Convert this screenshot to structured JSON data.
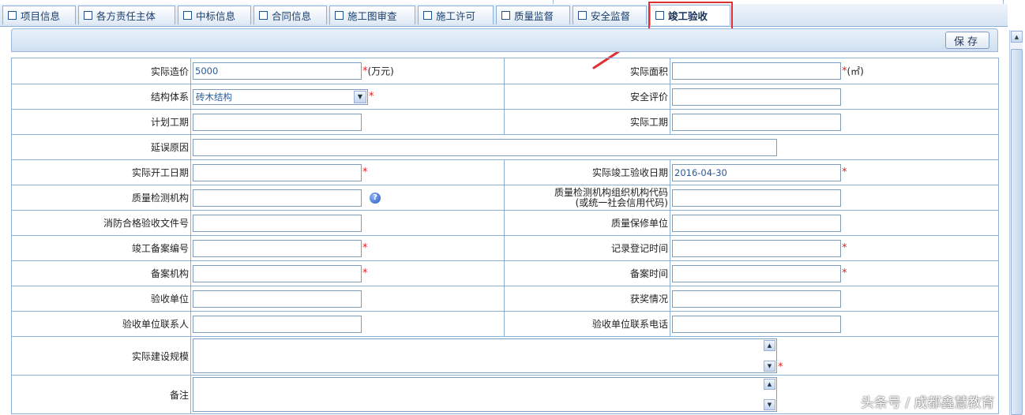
{
  "tabs": [
    {
      "label": "项目信息"
    },
    {
      "label": "各方责任主体"
    },
    {
      "label": "中标信息"
    },
    {
      "label": "合同信息"
    },
    {
      "label": "施工图审查"
    },
    {
      "label": "施工许可"
    },
    {
      "label": "质量监督"
    },
    {
      "label": "安全监督"
    },
    {
      "label": "竣工验收",
      "active": true
    }
  ],
  "toolbar": {
    "save_label": "保存"
  },
  "form": {
    "actual_cost": {
      "label": "实际造价",
      "value": "5000",
      "unit": "(万元)"
    },
    "actual_area": {
      "label": "实际面积",
      "value": "",
      "unit": "(㎡)"
    },
    "structure": {
      "label": "结构体系",
      "value": "砖木结构"
    },
    "safety_eval": {
      "label": "安全评价",
      "value": ""
    },
    "planned_period": {
      "label": "计划工期",
      "value": ""
    },
    "actual_period": {
      "label": "实际工期",
      "value": ""
    },
    "delay_reason": {
      "label": "延误原因",
      "value": ""
    },
    "start_date": {
      "label": "实际开工日期",
      "value": ""
    },
    "completion_date": {
      "label": "实际竣工验收日期",
      "value": "2016-04-30"
    },
    "quality_agency": {
      "label": "质量检测机构",
      "value": ""
    },
    "quality_agency_code": {
      "label_line1": "质量检测机构组织机构代码",
      "label_line2": "(或统一社会信用代码)",
      "value": ""
    },
    "fire_doc_no": {
      "label": "消防合格验收文件号",
      "value": ""
    },
    "warranty_unit": {
      "label": "质量保修单位",
      "value": ""
    },
    "filing_no": {
      "label": "竣工备案编号",
      "value": ""
    },
    "record_time": {
      "label": "记录登记时间",
      "value": ""
    },
    "filing_org": {
      "label": "备案机构",
      "value": ""
    },
    "filing_time": {
      "label": "备案时间",
      "value": ""
    },
    "accept_unit": {
      "label": "验收单位",
      "value": ""
    },
    "awards": {
      "label": "获奖情况",
      "value": ""
    },
    "accept_contact": {
      "label": "验收单位联系人",
      "value": ""
    },
    "accept_phone": {
      "label": "验收单位联系电话",
      "value": ""
    },
    "build_scale": {
      "label": "实际建设规模",
      "value": ""
    },
    "remark": {
      "label": "备注",
      "value": ""
    }
  },
  "required_mark": "*",
  "watermark": "头条号 / 成都鑫慧教育",
  "colors": {
    "highlight": "#e03030",
    "border": "#8fb0d6",
    "required": "#e02020"
  }
}
